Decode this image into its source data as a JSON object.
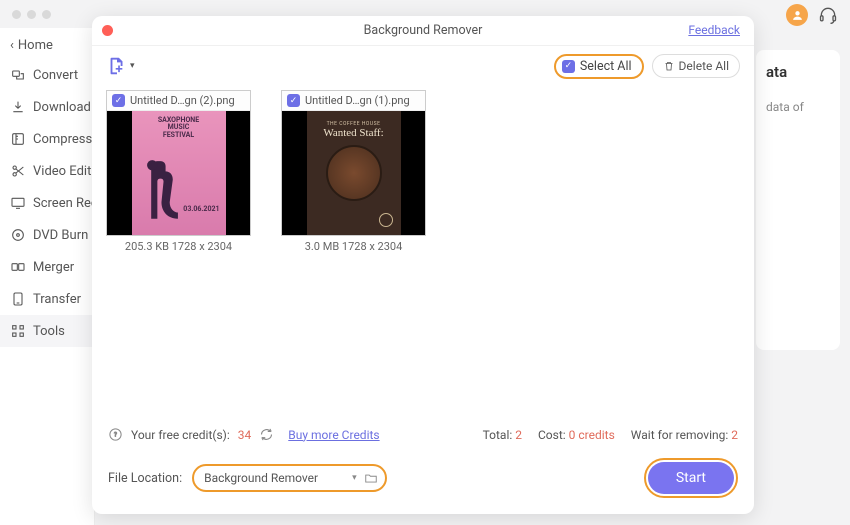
{
  "window": {
    "title": "Background Remover",
    "feedback": "Feedback"
  },
  "sidebar": {
    "back": "Home",
    "items": [
      {
        "label": "Convert",
        "icon": "convert"
      },
      {
        "label": "Download",
        "icon": "download"
      },
      {
        "label": "Compress",
        "icon": "compress"
      },
      {
        "label": "Video Edit",
        "icon": "video"
      },
      {
        "label": "Screen Rec",
        "icon": "screen"
      },
      {
        "label": "DVD Burn",
        "icon": "dvd"
      },
      {
        "label": "Merger",
        "icon": "merger"
      },
      {
        "label": "Transfer",
        "icon": "transfer"
      },
      {
        "label": "Tools",
        "icon": "tools"
      }
    ]
  },
  "toolbar": {
    "select_all": "Select All",
    "delete_all": "Delete All"
  },
  "files": [
    {
      "name": "Untitled D…gn (2).png",
      "meta": "205.3 KB 1728 x 2304",
      "poster": {
        "line1": "SAXOPHONE",
        "line2": "MUSIC",
        "line3": "FESTIVAL",
        "date": "03.06.2021"
      }
    },
    {
      "name": "Untitled D…gn (1).png",
      "meta": "3.0 MB 1728 x 2304",
      "poster": {
        "sub": "THE COFFEE HOUSE",
        "title": "Wanted Staff:"
      }
    }
  ],
  "credits": {
    "label": "Your free credit(s):",
    "value": "34",
    "buy": "Buy more Credits"
  },
  "status": {
    "total_label": "Total:",
    "total_value": "2",
    "cost_label": "Cost:",
    "cost_value": "0 credits",
    "wait_label": "Wait for removing:",
    "wait_value": "2"
  },
  "location": {
    "label": "File Location:",
    "value": "Background Remover"
  },
  "start": "Start",
  "bg_panel": {
    "title": "ata",
    "line": "data of"
  }
}
